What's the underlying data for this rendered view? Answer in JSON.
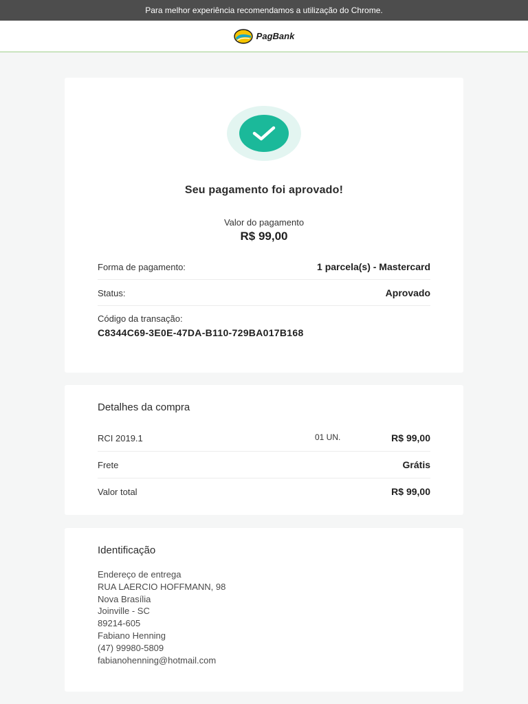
{
  "browser_notice": "Para melhor experiência recomendamos a utilização do Chrome.",
  "brand": {
    "name": "PagBank",
    "icon": "pagbank-logo-icon"
  },
  "approval": {
    "icon": "check-icon",
    "title": "Seu pagamento foi aprovado!",
    "amount_label": "Valor do pagamento",
    "amount_value": "R$ 99,00",
    "payment_method_label": "Forma de pagamento:",
    "payment_method_value": "1 parcela(s) - Mastercard",
    "status_label": "Status:",
    "status_value": "Aprovado",
    "transaction_label": "Código da transação:",
    "transaction_code": "C8344C69-3E0E-47DA-B110-729BA017B168"
  },
  "purchase_details": {
    "title": "Detalhes da compra",
    "item": {
      "name": "RCI 2019.1",
      "quantity": "01 UN.",
      "price": "R$ 99,00"
    },
    "freight_label": "Frete",
    "freight_value": "Grátis",
    "total_label": "Valor total",
    "total_value": "R$ 99,00"
  },
  "identification": {
    "title": "Identificação",
    "lines": [
      "Endereço de entrega",
      "RUA LAERCIO HOFFMANN, 98",
      "Nova Brasília",
      "Joinville - SC",
      "89214-605",
      "Fabiano Henning",
      "(47) 99980-5809",
      "fabianohenning@hotmail.com"
    ]
  },
  "colors": {
    "topbar": "#4d4d4d",
    "success": "#1bb99a",
    "success_halo": "#e3f5f1",
    "header_border": "#9fcf8a"
  }
}
